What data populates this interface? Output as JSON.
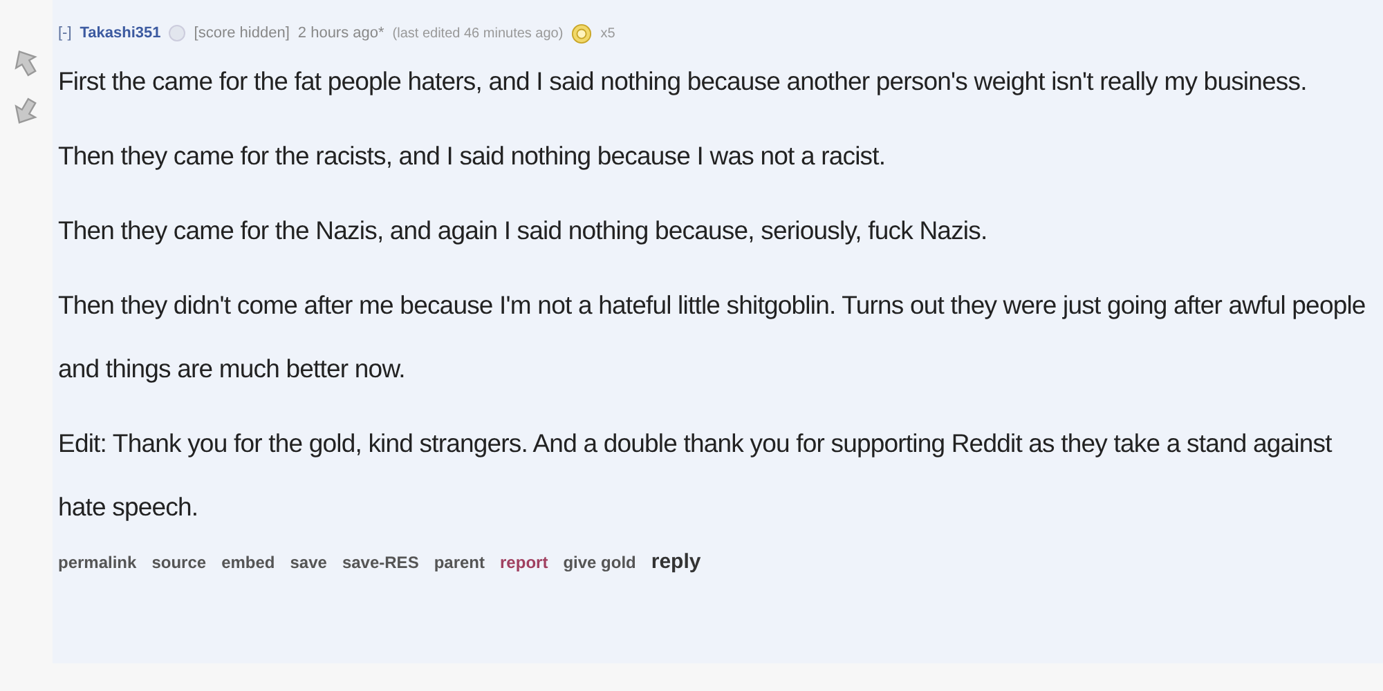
{
  "comment": {
    "collapse": "[-]",
    "author": "Takashi351",
    "score": "[score hidden]",
    "time": "2 hours ago*",
    "edited": "(last edited 46 minutes ago)",
    "gold_count": "x5",
    "paragraphs": [
      "First the came for the fat people haters, and I said nothing because another person's weight isn't really my business.",
      "Then they came for the racists, and I said nothing because I was not a racist.",
      "Then they came for the Nazis, and again I said nothing because, seriously, fuck Nazis.",
      "Then they didn't come after me because I'm not a hateful little shitgoblin. Turns out they were just going after awful people and things are much better now.",
      "Edit: Thank you for the gold, kind strangers. And a double thank you for supporting Reddit as they take a stand against hate speech."
    ],
    "links": [
      {
        "label": "permalink",
        "kind": "plain"
      },
      {
        "label": "source",
        "kind": "plain"
      },
      {
        "label": "embed",
        "kind": "plain"
      },
      {
        "label": "save",
        "kind": "plain"
      },
      {
        "label": "save-RES",
        "kind": "plain"
      },
      {
        "label": "parent",
        "kind": "plain"
      },
      {
        "label": "report",
        "kind": "warn"
      },
      {
        "label": "give gold",
        "kind": "plain"
      },
      {
        "label": "reply",
        "kind": "strong"
      }
    ]
  }
}
